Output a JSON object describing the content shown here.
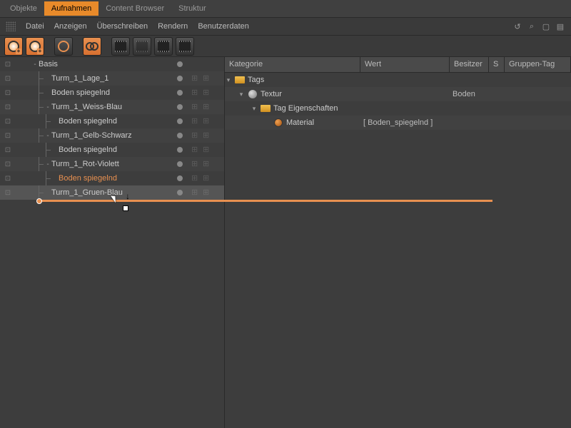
{
  "tabs": [
    "Objekte",
    "Aufnahmen",
    "Content Browser",
    "Struktur"
  ],
  "active_tab": 1,
  "menu": [
    "Datei",
    "Anzeigen",
    "Überschreiben",
    "Rendern",
    "Benutzerdaten"
  ],
  "tree": [
    {
      "label": "Basis",
      "depth": 0,
      "expander": "-",
      "highlight": false,
      "tags": false
    },
    {
      "label": "Turm_1_Lage_1",
      "depth": 1,
      "expander": "",
      "highlight": false,
      "tags": true
    },
    {
      "label": "Boden spiegelnd",
      "depth": 1,
      "expander": "",
      "highlight": false,
      "tags": true
    },
    {
      "label": "Turm_1_Weiss-Blau",
      "depth": 1,
      "expander": "-",
      "highlight": false,
      "tags": true
    },
    {
      "label": "Boden spiegelnd",
      "depth": 2,
      "expander": "",
      "highlight": false,
      "tags": true
    },
    {
      "label": "Turm_1_Gelb-Schwarz",
      "depth": 1,
      "expander": "-",
      "highlight": false,
      "tags": true
    },
    {
      "label": "Boden spiegelnd",
      "depth": 2,
      "expander": "",
      "highlight": false,
      "tags": true
    },
    {
      "label": "Turm_1_Rot-Violett",
      "depth": 1,
      "expander": "-",
      "highlight": false,
      "tags": true
    },
    {
      "label": "Boden spiegelnd",
      "depth": 2,
      "expander": "",
      "highlight": true,
      "tags": true
    },
    {
      "label": "Turm_1_Gruen-Blau",
      "depth": 1,
      "expander": "",
      "highlight": false,
      "tags": true,
      "selected": true
    }
  ],
  "headers": {
    "kat": "Kategorie",
    "wert": "Wert",
    "bes": "Besitzer",
    "s": "S",
    "grp": "Gruppen-Tag"
  },
  "props": [
    {
      "label": "Tags",
      "depth": 0,
      "exp": "▾",
      "icon": "folder",
      "wert": "",
      "bes": ""
    },
    {
      "label": "Textur",
      "depth": 1,
      "exp": "▾",
      "icon": "sphere",
      "wert": "",
      "bes": "Boden"
    },
    {
      "label": "Tag Eigenschaften",
      "depth": 2,
      "exp": "▾",
      "icon": "folder",
      "wert": "",
      "bes": ""
    },
    {
      "label": "Material",
      "depth": 3,
      "exp": "",
      "icon": "mat",
      "wert": "[ Boden_spiegelnd ]",
      "bes": ""
    }
  ]
}
